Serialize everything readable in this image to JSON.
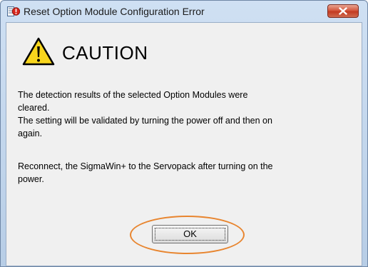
{
  "window": {
    "title": "Reset Option Module Configuration Error"
  },
  "dialog": {
    "heading": "CAUTION",
    "message_lines": [
      "The detection results of the selected Option Modules were",
      "cleared.",
      "The setting will be validated by turning the power off and then on",
      "again.",
      "Reconnect, the SigmaWin+ to the Servopack after turning on the",
      "power."
    ],
    "ok_label": "OK"
  },
  "icons": {
    "app": "error-app-icon",
    "close": "close-icon",
    "caution": "warning-triangle-icon"
  },
  "colors": {
    "titlebar": "#c4d7ee",
    "close_button": "#c94a30",
    "highlight": "#e8852f",
    "client_background": "#f0f0f0"
  }
}
